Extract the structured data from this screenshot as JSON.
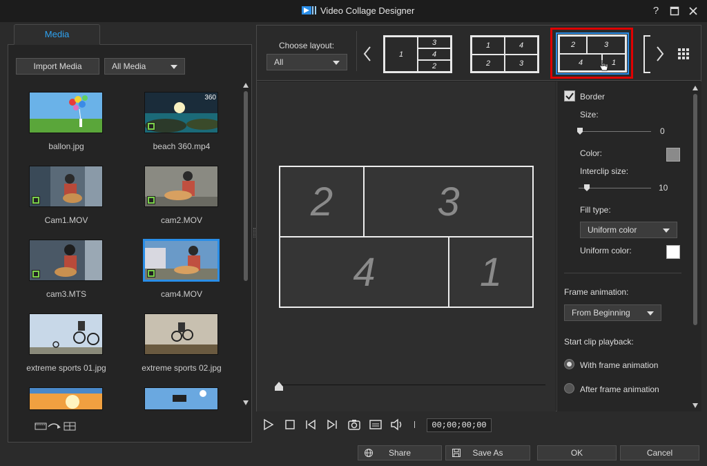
{
  "window": {
    "title": "Video Collage Designer",
    "help": "?",
    "maximize": "☐",
    "close": "✕"
  },
  "media": {
    "tab": "Media",
    "import_label": "Import Media",
    "filter": "All Media",
    "items": [
      {
        "name": "ballon.jpg"
      },
      {
        "name": "beach 360.mp4",
        "badge": "360"
      },
      {
        "name": "Cam1.MOV"
      },
      {
        "name": "cam2.MOV"
      },
      {
        "name": "cam3.MTS"
      },
      {
        "name": "cam4.MOV"
      },
      {
        "name": "extreme sports 01.jpg"
      },
      {
        "name": "extreme sports 02.jpg"
      }
    ]
  },
  "layouts": {
    "choose_label": "Choose layout:",
    "filter": "All",
    "l1": [
      "1",
      "3",
      "4",
      "2"
    ],
    "l2": [
      "1",
      "4",
      "2",
      "3"
    ],
    "l3": [
      "2",
      "3",
      "4",
      "1"
    ]
  },
  "collage": {
    "cells": [
      "2",
      "3",
      "4",
      "1"
    ]
  },
  "props": {
    "border_label": "Border",
    "size_label": "Size:",
    "size_value": "0",
    "color_label": "Color:",
    "interclip_label": "Interclip size:",
    "interclip_value": "10",
    "filltype_label": "Fill type:",
    "filltype_value": "Uniform color",
    "uniform_label": "Uniform color:",
    "frame_anim_label": "Frame animation:",
    "frame_anim_value": "From Beginning",
    "start_clip_label": "Start clip playback:",
    "opt_with": "With frame animation",
    "opt_after": "After frame animation",
    "colors": {
      "border_color": "#8a8a8a",
      "uniform_color": "#ffffff",
      "accent": "#2a8ee8",
      "highlight": "#e00000"
    }
  },
  "player": {
    "timecode": "00;00;00;00"
  },
  "footer": {
    "share": "Share",
    "save_as": "Save As",
    "ok": "OK",
    "cancel": "Cancel"
  }
}
